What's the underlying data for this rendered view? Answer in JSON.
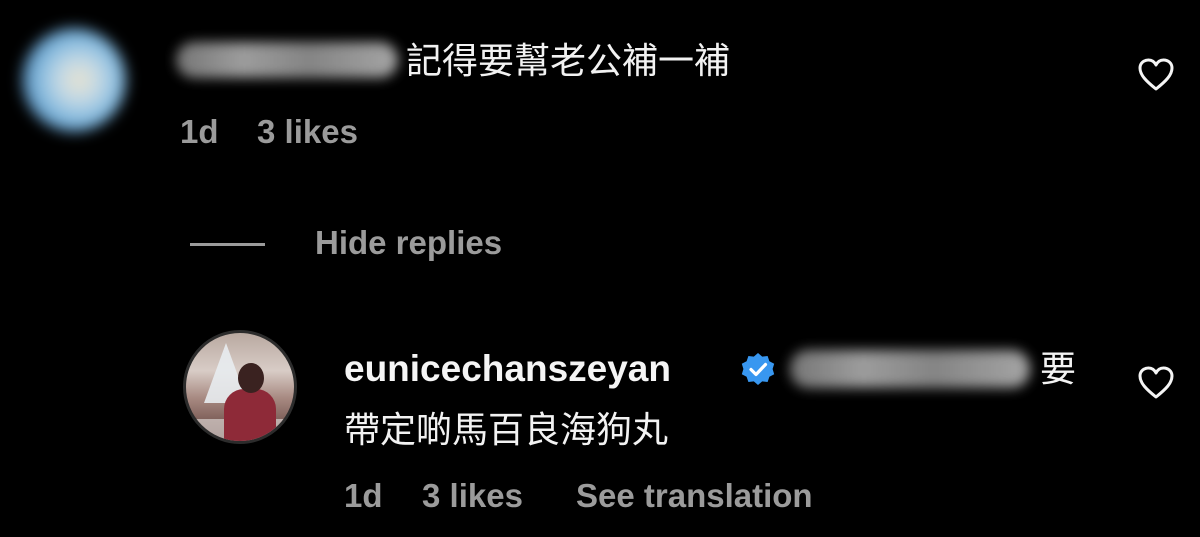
{
  "comment": {
    "text": "記得要幫老公補一補",
    "time": "1d",
    "likes": "3 likes",
    "like_icon": "heart-outline-icon"
  },
  "thread": {
    "hide_replies_label": "Hide replies"
  },
  "reply": {
    "username": "eunicechanszeyan",
    "verified_icon": "verified-badge-icon",
    "text_line1": "要",
    "text_line2": "帶定啲馬百良海狗丸",
    "time": "1d",
    "likes": "3 likes",
    "translate_label": "See translation",
    "like_icon": "heart-outline-icon"
  },
  "colors": {
    "background": "#000000",
    "primary_text": "#f5f5f5",
    "secondary_text": "#9b9b9b",
    "verified_blue": "#3897f0"
  }
}
